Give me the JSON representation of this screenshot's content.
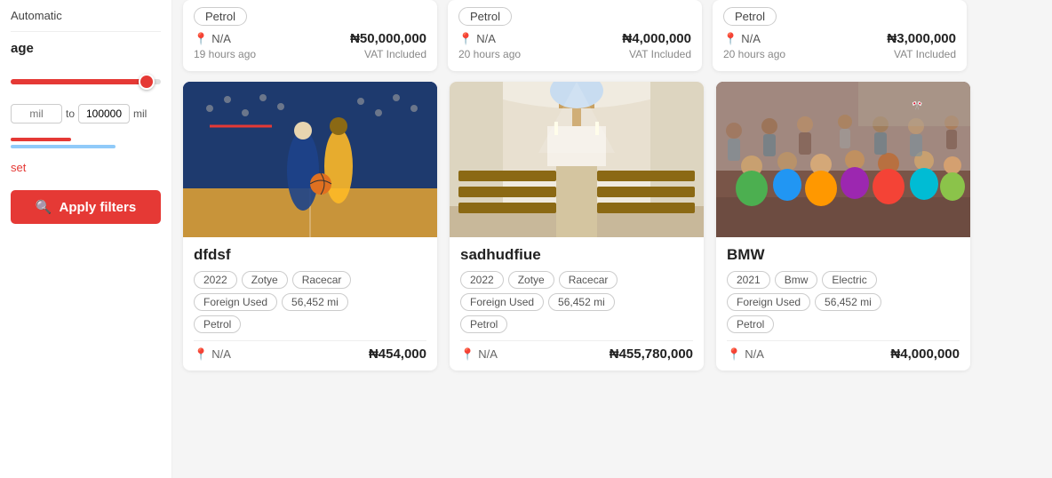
{
  "sidebar": {
    "transmission_label": "Automatic",
    "mileage_section": "age",
    "mileage_min": "",
    "mileage_min_placeholder": "mil",
    "mileage_to_label": "to",
    "mileage_max": "100000",
    "mileage_max_placeholder": "mil",
    "reset_label": "set",
    "apply_label": "Apply filters"
  },
  "top_cards": [
    {
      "fuel": "Petrol",
      "location": "N/A",
      "price": "₦50,000,000",
      "time_ago": "19 hours ago",
      "vat": "VAT Included"
    },
    {
      "fuel": "Petrol",
      "location": "N/A",
      "price": "₦4,000,000",
      "time_ago": "20 hours ago",
      "vat": "VAT Included"
    },
    {
      "fuel": "Petrol",
      "location": "N/A",
      "price": "₦3,000,000",
      "time_ago": "20 hours ago",
      "vat": "VAT Included"
    }
  ],
  "cards": [
    {
      "id": "card1",
      "title": "dfdsf",
      "image_type": "basketball",
      "tags": [
        "2022",
        "Zotye",
        "Racecar",
        "Foreign Used",
        "56,452 mi",
        "Petrol"
      ],
      "location": "N/A",
      "price": "₦454,000"
    },
    {
      "id": "card2",
      "title": "sadhudfiue",
      "image_type": "church",
      "tags": [
        "2022",
        "Zotye",
        "Racecar",
        "Foreign Used",
        "56,452 mi",
        "Petrol"
      ],
      "location": "N/A",
      "price": "₦455,780,000"
    },
    {
      "id": "card3",
      "title": "BMW",
      "image_type": "crowd",
      "tags": [
        "2021",
        "Bmw",
        "Electric",
        "Foreign Used",
        "56,452 mi",
        "Petrol"
      ],
      "location": "N/A",
      "price": "₦4,000,000"
    }
  ]
}
